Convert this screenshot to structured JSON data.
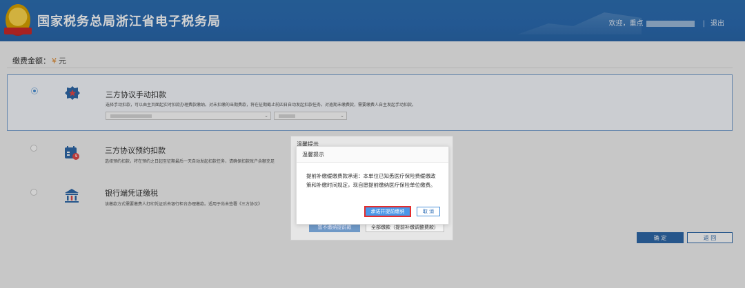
{
  "header": {
    "app_title": "国家税务总局浙江省电子税务局",
    "welcome": "欢迎，重点",
    "logout": "退出"
  },
  "payment": {
    "amount_label": "缴费金额：",
    "currency_symbol": "¥",
    "unit": "元"
  },
  "options": [
    {
      "title": "三方协议手动扣款",
      "desc": "选择手动扣款，可以由主页面起实时扣款办理费款缴纳。对未扣缴的当期费款，将在征期截止前四日自动发起扣款任务。对逾期未缴费款，需要缴费人自主发起手动扣款。",
      "selected": true
    },
    {
      "title": "三方协议预约扣款",
      "desc": "选择预约扣款，将在预约之日起至征期最后一天自动发起扣款任务，请确保扣款账户余额充足",
      "selected": false
    },
    {
      "title": "银行端凭证缴税",
      "desc": "该缴款方式需要缴费人打印凭证后去银行柜台办理缴款。适用于尚未签署《三方协议》",
      "selected": false
    }
  ],
  "back_dialog": {
    "title": "温馨提示",
    "btn1": "暂不缴纳提前款",
    "btn2": "全部缴款（提前补缴调整费款）"
  },
  "dialog": {
    "title": "温馨提示",
    "message": "提前补缴缓缴费款承诺：本单位已知悉医疗保险费缓缴政策和补缴时间规定，现自愿提前缴纳医疗保险单位缴费。",
    "confirm": "承诺并提前缴纳",
    "cancel": "取 消"
  },
  "footer": {
    "ok": "确 定",
    "return": "返 回"
  },
  "colors": {
    "header_blue": "#2b6cb2",
    "primary_blue": "#4a97e8",
    "highlight_red": "#e42c2c"
  }
}
